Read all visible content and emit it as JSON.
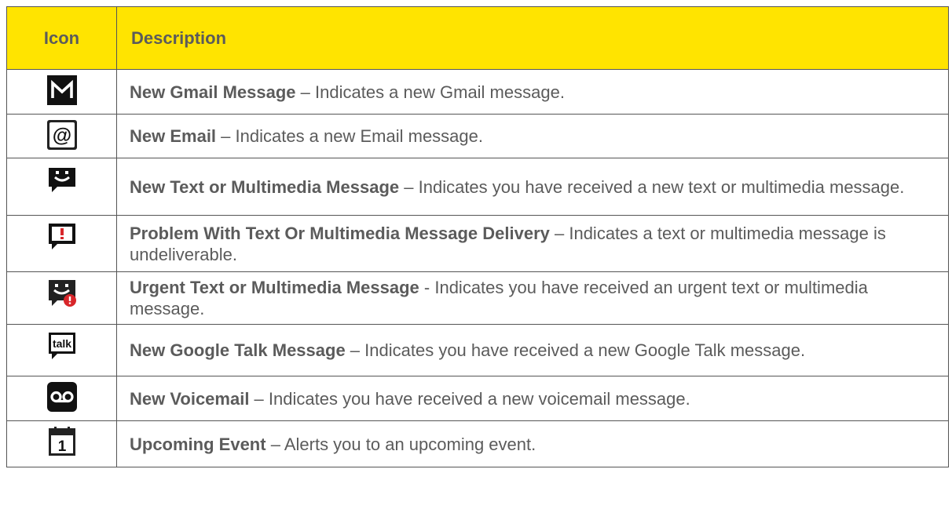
{
  "header": {
    "icon": "Icon",
    "description": "Description"
  },
  "rows": [
    {
      "icon": "gmail-icon",
      "title": "New Gmail Message",
      "sep": " – ",
      "text": "Indicates a new Gmail message."
    },
    {
      "icon": "email-at-icon",
      "title": "New Email",
      "sep": " – ",
      "text": "Indicates a new Email message."
    },
    {
      "icon": "text-message-smiley-icon",
      "title": "New Text or Multimedia Message",
      "sep": " – ",
      "text": "Indicates you have received a new text or multimedia message."
    },
    {
      "icon": "message-problem-icon",
      "title": "Problem With Text Or Multimedia Message Delivery",
      "sep": " – ",
      "text": "Indicates a text or multimedia message is undeliverable."
    },
    {
      "icon": "urgent-message-icon",
      "title": "Urgent Text or Multimedia Message",
      "sep": " - ",
      "text": "Indicates you have received an urgent text or multimedia message."
    },
    {
      "icon": "google-talk-icon",
      "title": "New Google Talk Message",
      "sep": " – ",
      "text": "Indicates you have received a new Google Talk message.",
      "icon_text": "talk"
    },
    {
      "icon": "voicemail-icon",
      "title": "New Voicemail",
      "sep": " – ",
      "text": "Indicates you have received a new voicemail message."
    },
    {
      "icon": "calendar-event-icon",
      "title": "Upcoming Event",
      "sep": " – ",
      "text": "Alerts you to an upcoming event.",
      "icon_text": "1"
    }
  ],
  "colors": {
    "header_bg": "#ffe400",
    "text": "#5b5b5b",
    "border": "#555555",
    "icon_dark": "#1a1a1a",
    "urgent_red": "#d8262a"
  }
}
